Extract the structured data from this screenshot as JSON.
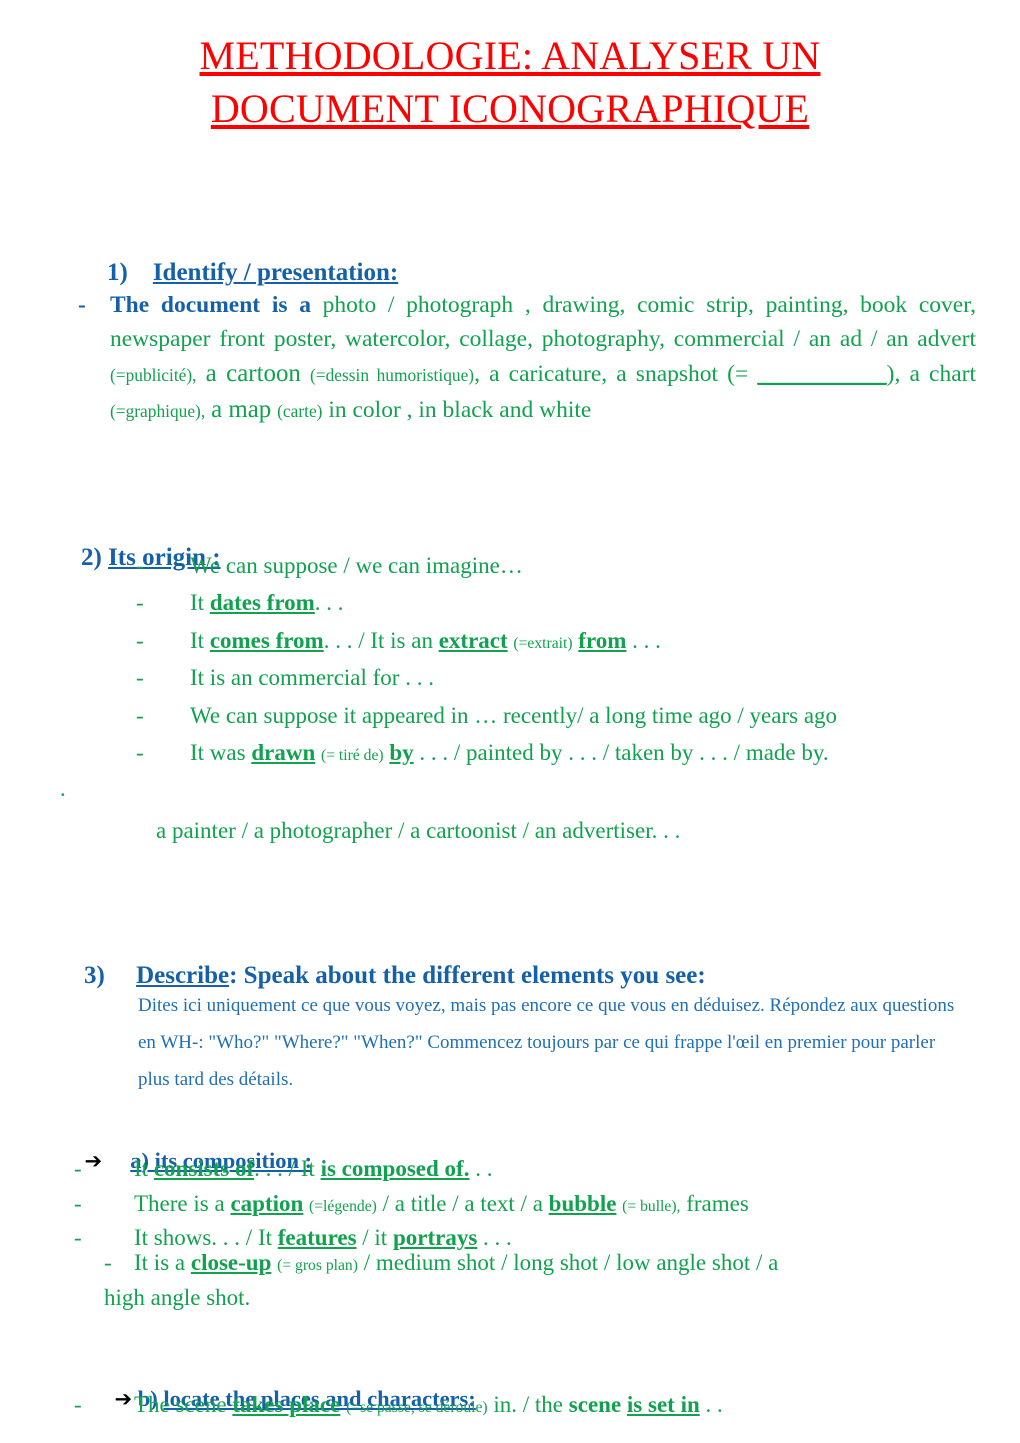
{
  "document": {
    "title_line1": "METHODOLOGIE: ANALYSER UN",
    "title_line2": "DOCUMENT ICONOGRAPHIQUE",
    "title_color": "#FF0000",
    "accent_blue": "#1560A8",
    "note_blue": "#1F6FB5",
    "accent_green": "#11A14F"
  },
  "section1": {
    "number": "1)",
    "heading": "Identify / presentation:",
    "bullet": "-",
    "lead": "The document is a",
    "options_run1": "photo / photograph , drawing,  comic strip, painting,  book cover,    newspaper front poster, watercolor, collage, photography, commercial / an ad / an advert",
    "gloss1": "(=publicité),",
    "option_cartoon": "a cartoon",
    "gloss2": "(=dessin humoristique)",
    "options_run2": ", a caricature, a snapshot (=",
    "blank": "___________",
    "options_run3": "), a chart",
    "gloss3": "(=graphique),",
    "option_map": "a map",
    "gloss4": "(carte)",
    "options_run4": "in color , in black and white"
  },
  "section2": {
    "number": "2)",
    "heading": "Its origin :",
    "items": [
      {
        "bullet": "-",
        "parts": [
          {
            "text": "We can suppose / we can imagine…",
            "style": "plain"
          }
        ]
      },
      {
        "bullet": "-",
        "parts": [
          {
            "text": "It ",
            "style": "plain"
          },
          {
            "text": "dates from",
            "style": "bold-underline"
          },
          {
            "text": ". . .",
            "style": "plain"
          }
        ]
      },
      {
        "bullet": "-",
        "parts": [
          {
            "text": " It ",
            "style": "plain"
          },
          {
            "text": "comes from",
            "style": "bold-underline"
          },
          {
            "text": ". . . / It is an ",
            "style": "plain"
          },
          {
            "text": "extract",
            "style": "bold-underline"
          },
          {
            "text": "  ",
            "style": "plain"
          },
          {
            "text": "(=extrait)",
            "style": "gloss"
          },
          {
            "text": " ",
            "style": "plain"
          },
          {
            "text": "from",
            "style": "bold-underline"
          },
          {
            "text": " . . .",
            "style": "plain"
          }
        ]
      },
      {
        "bullet": "-",
        "parts": [
          {
            "text": " It is an commercial for . . .",
            "style": "plain"
          }
        ]
      },
      {
        "bullet": "-",
        "parts": [
          {
            "text": "We can suppose it appeared in …        recently/ a long time ago / years ago",
            "style": "plain"
          }
        ]
      },
      {
        "bullet": "-",
        "parts": [
          {
            "text": "It was ",
            "style": "plain"
          },
          {
            "text": "drawn",
            "style": "bold-underline"
          },
          {
            "text": " ",
            "style": "plain"
          },
          {
            "text": "(= tiré de)",
            "style": "gloss"
          },
          {
            "text": " ",
            "style": "plain"
          },
          {
            "text": "by",
            "style": "bold-underline"
          },
          {
            "text": " . . . / painted by . . . / taken by . . . / made by.",
            "style": "plain"
          }
        ]
      }
    ],
    "orphan_dot": ".",
    "painters_line": "a painter / a photographer / a cartoonist / an advertiser. . ."
  },
  "section3": {
    "number": "3)",
    "heading_underlined": "Describe",
    "heading_rest": ": Speak about the different elements you see:",
    "note": "Dites ici uniquement ce que vous voyez, mais pas encore ce que vous en déduisez. Répondez aux questions en WH-: \"Who?\" \"Where?\" \"When?\" Commencez toujours par ce qui frappe l'œil en premier pour parler plus tard des détails.",
    "sub_a": {
      "arrow": "➔",
      "label_a": "a",
      "label_rest": ") its composition :",
      "items": [
        {
          "bullet": "-",
          "parts": [
            {
              "text": "It ",
              "style": "plain"
            },
            {
              "text": "consists of",
              "style": "bold-underline"
            },
            {
              "text": ". . . / It ",
              "style": "plain"
            },
            {
              "text": "is composed of.",
              "style": "bold-underline"
            },
            {
              "text": " . .",
              "style": "plain"
            }
          ]
        },
        {
          "bullet": "-",
          "parts": [
            {
              "text": "There is a ",
              "style": "plain"
            },
            {
              "text": "caption",
              "style": "bold-underline"
            },
            {
              "text": " ",
              "style": "plain"
            },
            {
              "text": "(=légende)",
              "style": "gloss"
            },
            {
              "text": " / a title / a text / a ",
              "style": "plain"
            },
            {
              "text": "bubble",
              "style": "bold-underline"
            },
            {
              "text": " ",
              "style": "plain"
            },
            {
              "text": "(= bulle),",
              "style": "gloss"
            },
            {
              "text": " frames",
              "style": "plain"
            }
          ]
        },
        {
          "bullet": "-",
          "parts": [
            {
              "text": "It shows. . . / It ",
              "style": "plain"
            },
            {
              "text": "features",
              "style": "bold-underline"
            },
            {
              "text": " / it ",
              "style": "plain"
            },
            {
              "text": "portrays",
              "style": "bold-underline"
            },
            {
              "text": " . . .",
              "style": "plain"
            }
          ]
        }
      ],
      "closeup": {
        "bullet": "-",
        "parts": [
          {
            "text": "It is a ",
            "style": "plain"
          },
          {
            "text": "close-up",
            "style": "bold-underline"
          },
          {
            "text": " ",
            "style": "plain"
          },
          {
            "text": "(= gros plan)",
            "style": "gloss"
          },
          {
            "text": " / medium shot / long shot / low angle shot / a",
            "style": "plain"
          }
        ],
        "continuation": "high   angle shot."
      }
    },
    "sub_b": {
      "arrow": "➔",
      "label": "b) ",
      "label_underlined": "locate the places and characters:",
      "item": {
        "bullet": "-",
        "parts": [
          {
            "text": "The scene ",
            "style": "plain"
          },
          {
            "text": "takes place",
            "style": "bold-underline"
          },
          {
            "text": " ",
            "style": "plain"
          },
          {
            "text": "(=se passe, se déroule)",
            "style": "gloss"
          },
          {
            "text": " in. / the ",
            "style": "plain"
          },
          {
            "text": "scene",
            "style": "bold"
          },
          {
            "text": " ",
            "style": "plain"
          },
          {
            "text": "is set in",
            "style": "bold-underline"
          },
          {
            "text": " . .",
            "style": "plain"
          }
        ]
      }
    }
  }
}
